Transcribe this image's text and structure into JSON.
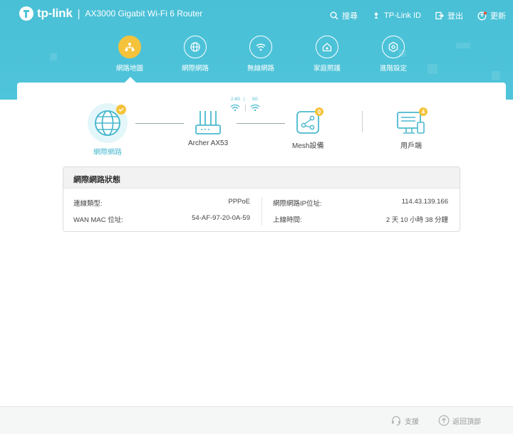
{
  "header": {
    "brand": "tp-link",
    "separator": "|",
    "model": "AX3000 Gigabit Wi-Fi 6 Router",
    "links": {
      "search": "搜尋",
      "tplink_id": "TP-Link ID",
      "logout": "登出",
      "update": "更新"
    }
  },
  "nav": {
    "items": [
      {
        "label": "網路地圖",
        "icon": "network-map-icon",
        "active": true
      },
      {
        "label": "網際網路",
        "icon": "internet-icon",
        "active": false
      },
      {
        "label": "無線網路",
        "icon": "wireless-icon",
        "active": false
      },
      {
        "label": "家庭照護",
        "icon": "home-care-icon",
        "active": false
      },
      {
        "label": "進階設定",
        "icon": "advanced-settings-icon",
        "active": false
      }
    ]
  },
  "topology": {
    "internet_label": "網際網路",
    "router_label": "Archer AX53",
    "band_24": "2.4G",
    "band_sep": "|",
    "band_5": "5G",
    "mesh_label": "Mesh設備",
    "mesh_count": "0",
    "clients_label": "用戶端",
    "clients_count": "4"
  },
  "status": {
    "title": "網際網路狀態",
    "connection_type_label": "連線類型:",
    "connection_type_value": "PPPoE",
    "wan_mac_label": "WAN MAC 位址:",
    "wan_mac_value": "54-AF-97-20-0A-59",
    "ip_label": "網際網路IP位址:",
    "ip_value": "114.43.139.166",
    "uptime_label": "上線時間:",
    "uptime_value": "2 天 10 小時 38 分鐘"
  },
  "footer": {
    "support": "支援",
    "back_to_top": "返回頂部"
  },
  "colors": {
    "header": "#4fc4da",
    "accent": "#4bb9cf",
    "badge": "#f5c33b"
  }
}
